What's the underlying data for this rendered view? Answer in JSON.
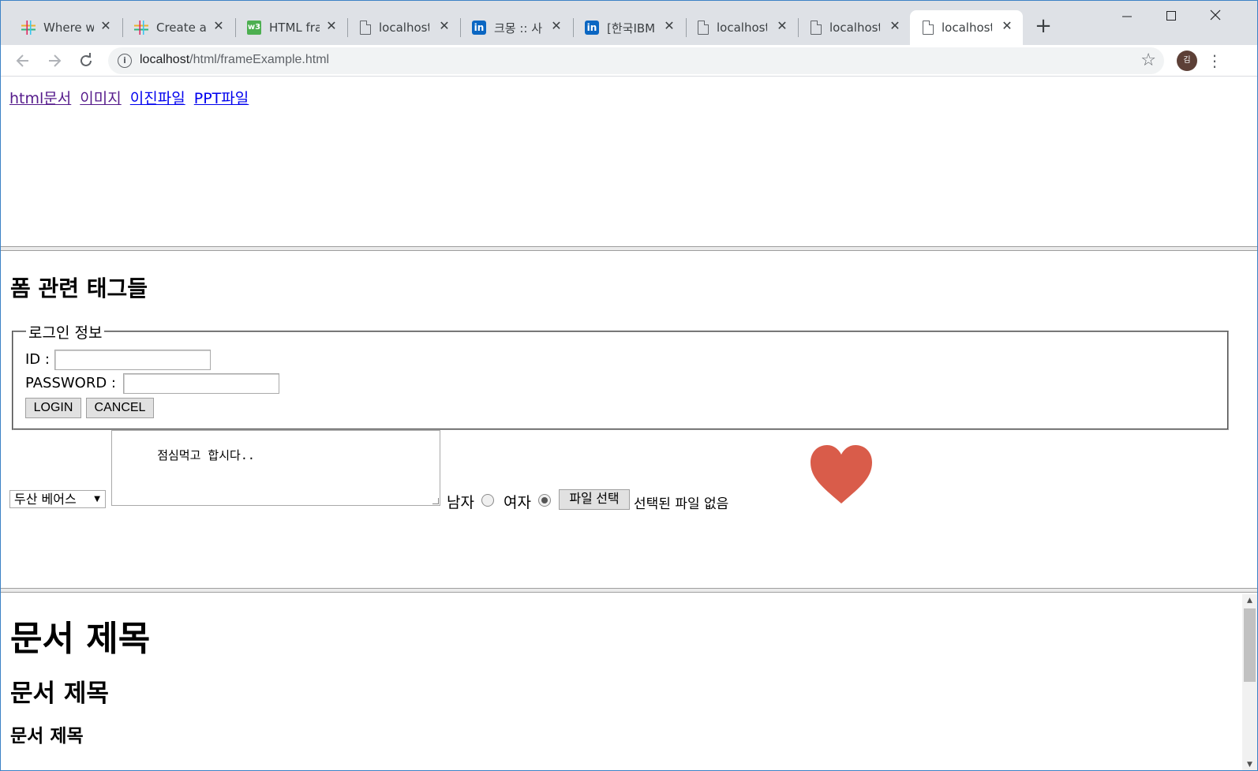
{
  "browser": {
    "tabs": [
      {
        "title": "Where w",
        "favicon": "slack-icon"
      },
      {
        "title": "Create a",
        "favicon": "slack-icon"
      },
      {
        "title": "HTML fra",
        "favicon": "w3schools-icon"
      },
      {
        "title": "localhost/",
        "favicon": "document-icon"
      },
      {
        "title": "크몽 :: 사",
        "favicon": "linkedin-icon"
      },
      {
        "title": "[한국IBM",
        "favicon": "linkedin-icon"
      },
      {
        "title": "localhost/",
        "favicon": "document-icon"
      },
      {
        "title": "localhost/",
        "favicon": "document-icon"
      },
      {
        "title": "localhost/",
        "favicon": "document-icon",
        "active": true
      }
    ],
    "close_glyph": "✕",
    "new_tab_glyph": "+",
    "w3_glyph": "w3",
    "in_glyph": "in",
    "url_host": "localhost",
    "url_path": "/html/frameExample.html",
    "avatar_initial": "김",
    "accent_color": "#3c82c6"
  },
  "top_frame": {
    "links": [
      {
        "label": "html문서",
        "visited": true
      },
      {
        "label": "이미지",
        "visited": true
      },
      {
        "label": "이진파일",
        "visited": false
      },
      {
        "label": "PPT파일",
        "visited": false
      }
    ]
  },
  "form_frame": {
    "heading": "폼 관련 태그들",
    "fieldset_legend": "로그인 정보",
    "id_label": "ID :",
    "id_value": "",
    "password_label": "PASSWORD :",
    "password_value": "",
    "login_button": "LOGIN",
    "cancel_button": "CANCEL",
    "select_value": "두산 베어스",
    "textarea_value": "점심먹고 합시다..",
    "radio_male_label": "남자",
    "radio_female_label": "여자",
    "radio_selected": "여자",
    "file_button": "파일 선택",
    "file_status": "선택된 파일 없음",
    "heart_color": "#d95c4a"
  },
  "doc_frame": {
    "h1": "문서 제목",
    "h2": "문서 제목",
    "h3": "문서 제목"
  }
}
